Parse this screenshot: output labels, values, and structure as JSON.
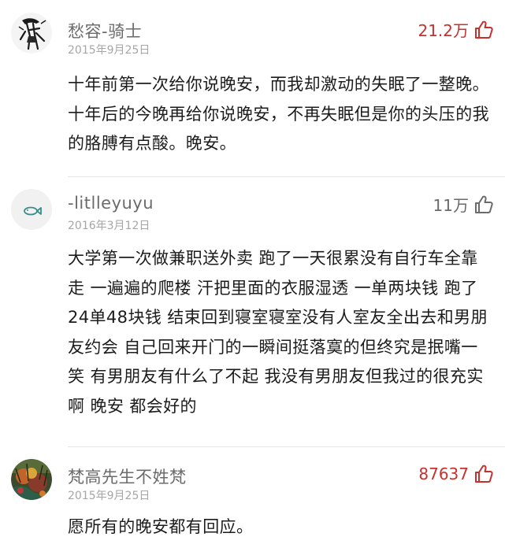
{
  "comments": [
    {
      "username": "愁容-骑士",
      "date": "2015年9月25日",
      "likes": "21.2万",
      "likes_style": "hot",
      "avatar_icon": "knight-avatar-icon",
      "text": "十年前第一次给你说晚安，而我却激动的失眠了一整晚。十年后的今晚再给你说晚安，不再失眠但是你的头压的我的胳膊有点酸。晚安。"
    },
    {
      "username": "-litlleyuyu",
      "date": "2016年3月12日",
      "likes": "11万",
      "likes_style": "normal",
      "avatar_icon": "fish-avatar-icon",
      "text": "大学第一次做兼职送外卖 跑了一天很累没有自行车全靠走 一遍遍的爬楼 汗把里面的衣服湿透 一单两块钱 跑了24单48块钱  结束回到寝室寝室没有人室友全出去和男朋友约会 自己回来开门的一瞬间挺落寞的但终究是抿嘴一笑 有男朋友有什么了不起 我没有男朋友但我过的很充实啊 晚安 都会好的"
    },
    {
      "username": "梵高先生不姓梵",
      "date": "2015年9月25日",
      "likes": "87637",
      "likes_style": "hot",
      "avatar_icon": "painting-avatar-icon",
      "text": "愿所有的晚安都有回应。"
    }
  ],
  "colors": {
    "hot_like": "#c7302d",
    "normal_like": "#6b6b6b",
    "username": "#6b6b6b",
    "date": "#a6a6a6",
    "divider": "#e6e6e6"
  }
}
